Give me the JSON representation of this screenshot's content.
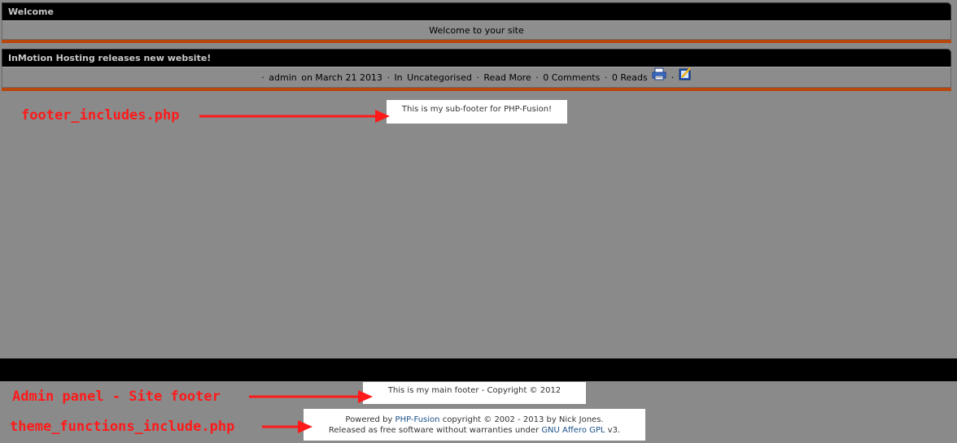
{
  "welcome_panel": {
    "title": "Welcome",
    "body": "Welcome to your site"
  },
  "news_panel": {
    "title": "InMotion Hosting releases new website!",
    "meta": {
      "sep": "·",
      "author": "admin",
      "date_text": "on March 21 2013",
      "category_prefix": "In",
      "category": "Uncategorised",
      "read_more": "Read More",
      "comments": "0 Comments",
      "reads": "0 Reads"
    },
    "icons": [
      "print-icon",
      "email-icon"
    ]
  },
  "subfooter": {
    "text": "This is my sub-footer for PHP-Fusion!"
  },
  "main_footer": {
    "text": "This is my main footer - Copyright © 2012"
  },
  "powered_by": {
    "prefix": "Powered by",
    "link": "PHP-Fusion",
    "suffix": "copyright © 2002 - 2013 by Nick Jones.",
    "line2_prefix": "Released as free software without warranties under",
    "license_link": "GNU Affero GPL",
    "line2_suffix": "v3."
  },
  "annotations": {
    "a1": "footer_includes.php",
    "a2": "Admin panel - Site footer",
    "a3": "theme_functions_include.php"
  },
  "colors": {
    "annotation": "#ff1a1a",
    "orange_rule": "#b8470d",
    "background": "#8a8a8a"
  }
}
